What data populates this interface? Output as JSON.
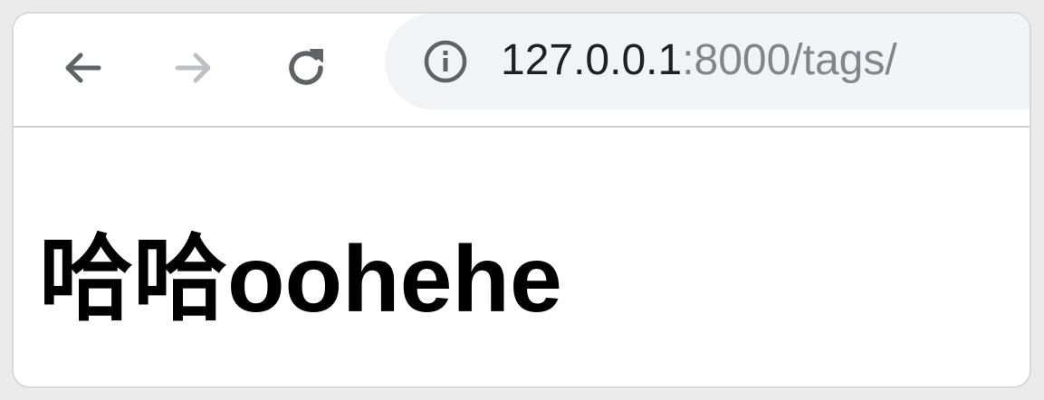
{
  "toolbar": {
    "back_icon": "arrow-left-icon",
    "forward_icon": "arrow-right-icon",
    "reload_icon": "reload-icon",
    "colors": {
      "icon_active": "#5f6368",
      "icon_disabled": "#bdc1c6",
      "omnibox_bg": "#f1f3f4"
    }
  },
  "address_bar": {
    "security_icon": "info-icon",
    "host": "127.0.0.1",
    "rest": ":8000/tags/",
    "colors": {
      "host": "#202124",
      "rest": "#80868b"
    }
  },
  "page": {
    "heading": "哈哈oohehe"
  }
}
